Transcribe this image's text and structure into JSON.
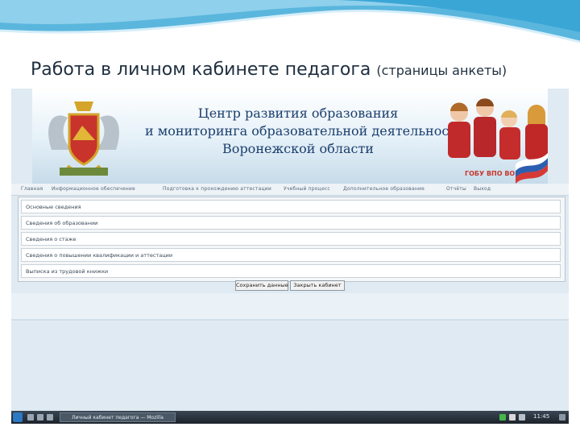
{
  "slide": {
    "title": "Работа в личном кабинете педагога",
    "subtitle": "(страницы анкеты)"
  },
  "banner": {
    "line1": "Центр развития образования",
    "line2": "и мониторинга образовательной деятельности",
    "line3": "Воронежской области",
    "label": "ГОБУ ВПО ВОЦМОД"
  },
  "nav": {
    "items": [
      "Главная",
      "Информационное обеспечение",
      "Подготовка к прохождению аттестации",
      "Учебный процесс",
      "Дополнительное образование",
      "Отчёты",
      "Выход"
    ]
  },
  "form": {
    "rows": [
      "Основные сведения",
      "Сведения об образовании",
      "Сведения о стаже",
      "Сведения о повышении квалификации и аттестации",
      "Выписка из трудовой книжки"
    ],
    "save_label": "Сохранить данные",
    "back_label": "Закрыть кабинет"
  },
  "taskbar": {
    "window_title": "Личный кабинет педагога — Mozilla",
    "tray_text": "11:45"
  },
  "colors": {
    "accent": "#1b3f6e",
    "taskbar": "#2a333d",
    "swoosh": "#5bb8e0"
  }
}
